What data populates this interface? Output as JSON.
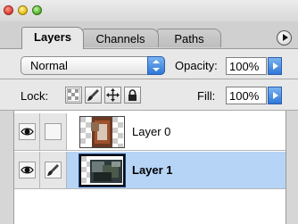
{
  "window": {
    "controls": [
      "close-button",
      "minimize-button",
      "zoom-button"
    ]
  },
  "tabs": [
    {
      "label": "Layers",
      "active": true
    },
    {
      "label": "Channels",
      "active": false
    },
    {
      "label": "Paths",
      "active": false
    }
  ],
  "blend": {
    "mode": "Normal",
    "opacity_label": "Opacity:",
    "opacity_value": "100%"
  },
  "lock": {
    "label": "Lock:",
    "buttons": [
      "lock-transparent-pixels",
      "lock-image-pixels",
      "lock-position",
      "lock-all"
    ],
    "fill_label": "Fill:",
    "fill_value": "100%"
  },
  "layers": [
    {
      "name": "Layer 0",
      "visible": true,
      "selected": false,
      "linked_brush": false
    },
    {
      "name": "Layer 1",
      "visible": true,
      "selected": true,
      "linked_brush": true
    }
  ],
  "colors": {
    "selected_row": "#b6d4f6",
    "accent_blue": "#2f78d8"
  }
}
